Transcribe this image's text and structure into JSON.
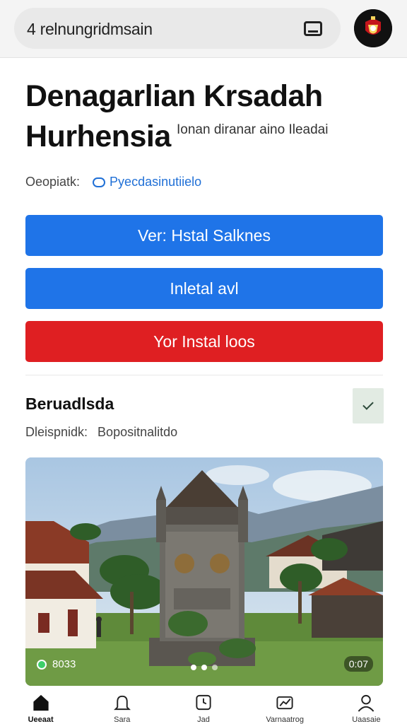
{
  "header": {
    "search_text": "4 relnungridmsain",
    "tab_icon": "tabs-icon",
    "avatar": "crest-avatar"
  },
  "app": {
    "title": "Denagarlian Krsadah Hurhensia",
    "subtitle": "Ionan diranar aino Ileadai",
    "meta_label": "Oeopiatk:",
    "meta_link": "Pyecdasinutiielo"
  },
  "buttons": {
    "primary": "Ver: Hstal Salknes",
    "secondary": "Inletal avl",
    "danger": "Yor Instal loos"
  },
  "section": {
    "title": "Beruadlsda",
    "meta_label": "Dleispnidk:",
    "meta_value": "Bopositnalitdo"
  },
  "photo": {
    "left_badge": "8033",
    "right_badge": "0:07"
  },
  "nav": [
    {
      "label": "Ueeaat",
      "icon": "home-icon"
    },
    {
      "label": "Sara",
      "icon": "bell-icon"
    },
    {
      "label": "Jad",
      "icon": "clock-icon"
    },
    {
      "label": "Varnaatrog",
      "icon": "chart-icon"
    },
    {
      "label": "Uaasaie",
      "icon": "person-icon"
    }
  ],
  "colors": {
    "primary": "#1f74e8",
    "danger": "#df1f22",
    "link": "#1f6fd6",
    "check_bg": "#e2ebe3"
  }
}
